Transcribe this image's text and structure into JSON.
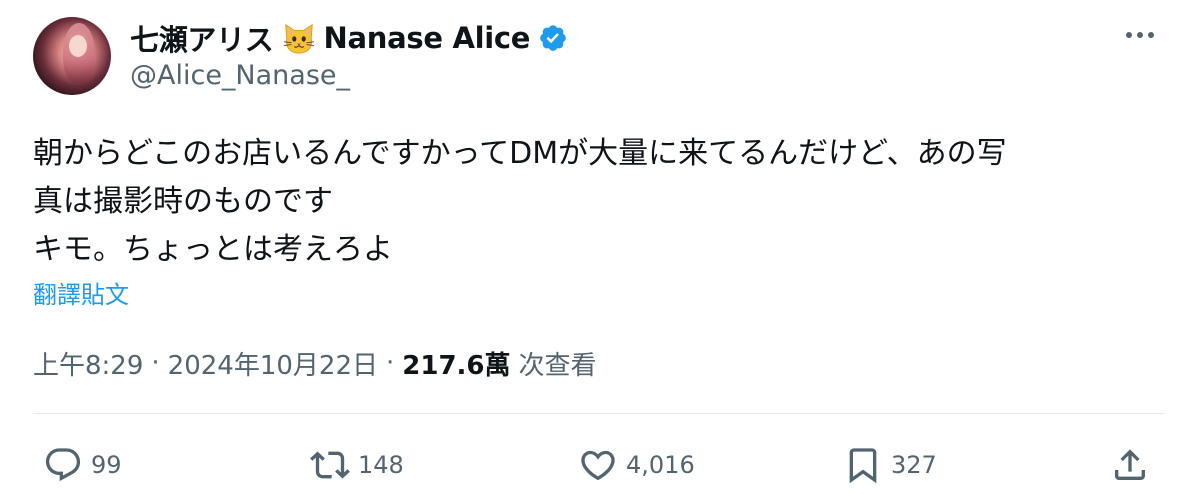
{
  "author": {
    "display_name": "七瀬アリス",
    "display_name_latin": "Nanase Alice",
    "handle": "@Alice_Nanase_",
    "emoji": "cat-face",
    "verified": true,
    "verified_color": "#1d9bf0"
  },
  "tweet": {
    "lines": [
      "朝からどこのお店いるんですかってDMが大量に来てるんだけど、あの写",
      "真は撮影時のものです",
      "キモ。ちょっとは考えろよ"
    ],
    "translate_label": "翻譯貼文"
  },
  "meta": {
    "time": "上午8:29",
    "date": "2024年10月22日",
    "views": "217.6萬",
    "views_suffix": "次查看",
    "separator": "·"
  },
  "actions": {
    "replies": "99",
    "retweets": "148",
    "likes": "4,016",
    "bookmarks": "327"
  },
  "colors": {
    "text": "#0f1419",
    "secondary": "#536471",
    "link": "#1d9bf0",
    "divider": "#e7e9ea"
  }
}
